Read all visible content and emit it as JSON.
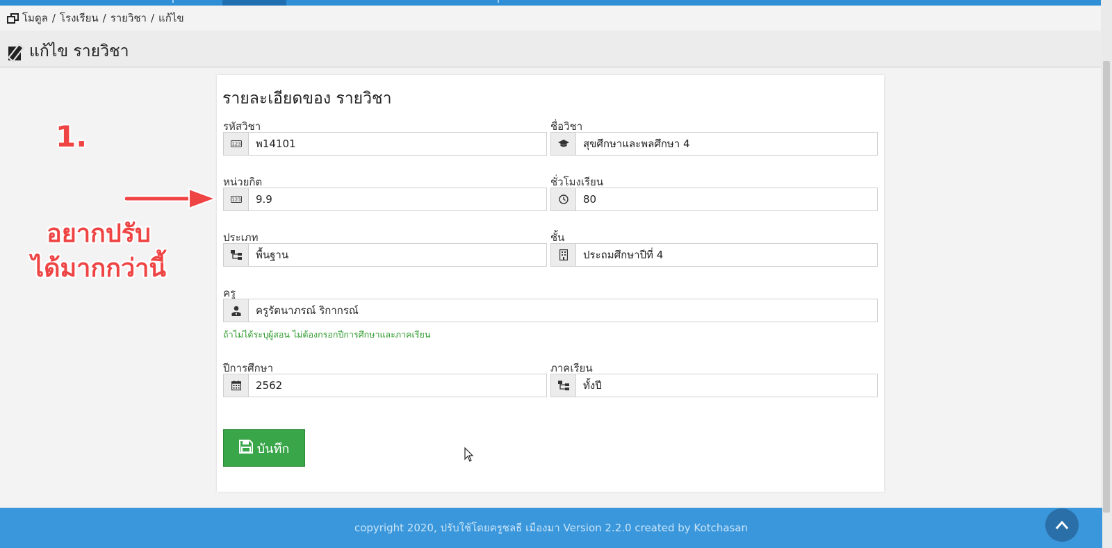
{
  "breadcrumb": {
    "items": [
      "โมดูล",
      "โรงเรียน",
      "รายวิชา",
      "แก้ไข"
    ],
    "separator": "/"
  },
  "page": {
    "title": "แก้ไข รายวิชา"
  },
  "form": {
    "title": "รายละเอียดของ รายวิชา",
    "fields": {
      "code": {
        "label": "รหัสวิชา",
        "value": "พ14101",
        "icon": "number-icon"
      },
      "name": {
        "label": "ชื่อวิชา",
        "value": "สุขศึกษาและพลศึกษา 4",
        "icon": "graduation-cap-icon"
      },
      "credit": {
        "label": "หน่วยกิต",
        "value": "9.9",
        "icon": "number-icon"
      },
      "period": {
        "label": "ชั่วโมงเรียน",
        "value": "80",
        "icon": "clock-icon"
      },
      "type": {
        "label": "ประเภท",
        "value": "พื้นฐาน",
        "icon": "sitemap-icon"
      },
      "class": {
        "label": "ชั้น",
        "value": "ประถมศึกษาปีที่ 4",
        "icon": "building-icon"
      },
      "teacher": {
        "label": "ครู",
        "value": "ครูรัตนาภรณ์ ริกากรณ์",
        "icon": "teacher-icon"
      },
      "year": {
        "label": "ปีการศึกษา",
        "value": "2562",
        "icon": "calendar-icon"
      },
      "term": {
        "label": "ภาคเรียน",
        "value": "ทั้งปี",
        "icon": "sitemap-icon"
      }
    },
    "hint": "ถ้าไม่ได้ระบุผู้สอน ไม่ต้องกรอกปีการศึกษาและภาคเรียน",
    "save_label": "บันทึก"
  },
  "annotation": {
    "number": "1.",
    "text_line1": "อยากปรับ",
    "text_line2": "ได้มากกว่านี้"
  },
  "footer": {
    "text": "copyright 2020, ปรับใช้โดยครูชลธี เมืองมา Version 2.2.0 created by Kotchasan"
  },
  "colors": {
    "topbar": "#2f8fd6",
    "footer": "#3a97db",
    "save_button": "#3aa64a",
    "hint": "#2e9a2e",
    "annotation": "#ef4444"
  }
}
